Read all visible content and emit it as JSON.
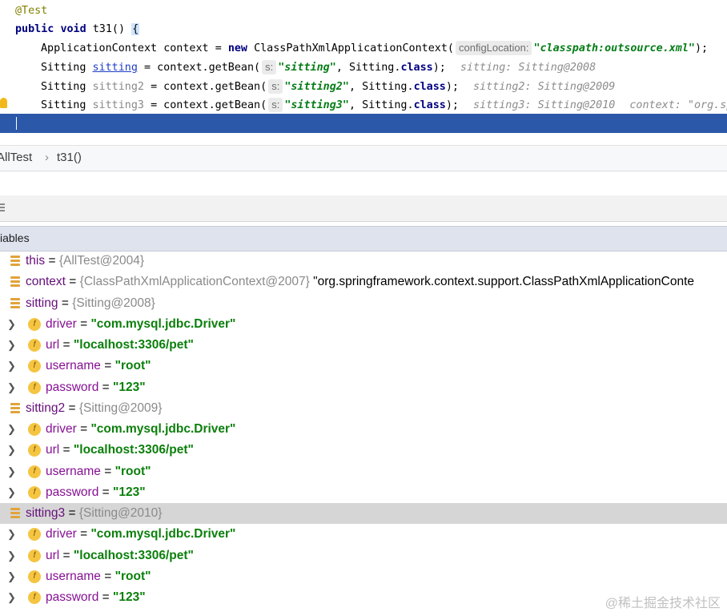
{
  "editor": {
    "annotation": "@Test",
    "method": {
      "kw1": "public",
      "kw2": "void",
      "name": "t31()",
      "brace": "{"
    },
    "line_context": {
      "type": "ApplicationContext",
      "var": "context",
      "eq": "=",
      "new_kw": "new",
      "ctor": "ClassPathXmlApplicationContext(",
      "hint": "configLocation:",
      "arg": "\"classpath:outsource.xml\"",
      "close": ");"
    },
    "bean_lines": [
      {
        "type": "Sitting",
        "var": "sitting",
        "call": "= context.getBean(",
        "hint": "s:",
        "arg": "\"sitting\"",
        "cls": "Sitting.",
        "cls_kw": "class",
        "close": ");",
        "inline": "sitting: Sitting@2008"
      },
      {
        "type": "Sitting",
        "var": "sitting2",
        "call": "= context.getBean(",
        "hint": "s:",
        "arg": "\"sitting2\"",
        "cls": "Sitting.",
        "cls_kw": "class",
        "close": ");",
        "inline": "sitting2: Sitting@2009"
      },
      {
        "type": "Sitting",
        "var": "sitting3",
        "call": "= context.getBean(",
        "hint": "s:",
        "arg": "\"sitting3\"",
        "cls": "Sitting.",
        "cls_kw": "class",
        "close": ");",
        "inline": "sitting3: Sitting@2010",
        "inline2": "context: \"org.sp"
      }
    ],
    "current_line_caret": "|"
  },
  "breadcrumbs": {
    "class": "AllTest",
    "separator": "›",
    "method": "t31()"
  },
  "variables_header": {
    "title": "iables"
  },
  "variables": [
    {
      "kind": "top",
      "name": "this",
      "eq": "=",
      "type": "{AllTest@2004}"
    },
    {
      "kind": "top",
      "name": "context",
      "eq": "=",
      "type": "{ClassPathXmlApplicationContext@2007}",
      "extra": "\"org.springframework.context.support.ClassPathXmlApplicationConte"
    },
    {
      "kind": "top",
      "name": "sitting",
      "eq": "=",
      "type": "{Sitting@2008}"
    },
    {
      "kind": "field",
      "name": "driver",
      "eq": "=",
      "value": "\"com.mysql.jdbc.Driver\""
    },
    {
      "kind": "field",
      "name": "url",
      "eq": "=",
      "value": "\"localhost:3306/pet\""
    },
    {
      "kind": "field",
      "name": "username",
      "eq": "=",
      "value": "\"root\""
    },
    {
      "kind": "field",
      "name": "password",
      "eq": "=",
      "value": "\"123\""
    },
    {
      "kind": "top",
      "name": "sitting2",
      "eq": "=",
      "type": "{Sitting@2009}"
    },
    {
      "kind": "field",
      "name": "driver",
      "eq": "=",
      "value": "\"com.mysql.jdbc.Driver\""
    },
    {
      "kind": "field",
      "name": "url",
      "eq": "=",
      "value": "\"localhost:3306/pet\""
    },
    {
      "kind": "field",
      "name": "username",
      "eq": "=",
      "value": "\"root\""
    },
    {
      "kind": "field",
      "name": "password",
      "eq": "=",
      "value": "\"123\""
    },
    {
      "kind": "top",
      "name": "sitting3",
      "eq": "=",
      "type": "{Sitting@2010}",
      "selected": true
    },
    {
      "kind": "field",
      "name": "driver",
      "eq": "=",
      "value": "\"com.mysql.jdbc.Driver\""
    },
    {
      "kind": "field",
      "name": "url",
      "eq": "=",
      "value": "\"localhost:3306/pet\""
    },
    {
      "kind": "field",
      "name": "username",
      "eq": "=",
      "value": "\"root\""
    },
    {
      "kind": "field",
      "name": "password",
      "eq": "=",
      "value": "\"123\""
    }
  ],
  "icons": {
    "expand": "chevron-right-icon",
    "field": "field-f-icon",
    "variable": "variable-lines-icon",
    "bulb": "lightbulb-icon"
  },
  "field_icon_letter": "f",
  "watermark": "@稀土掘金技术社区"
}
